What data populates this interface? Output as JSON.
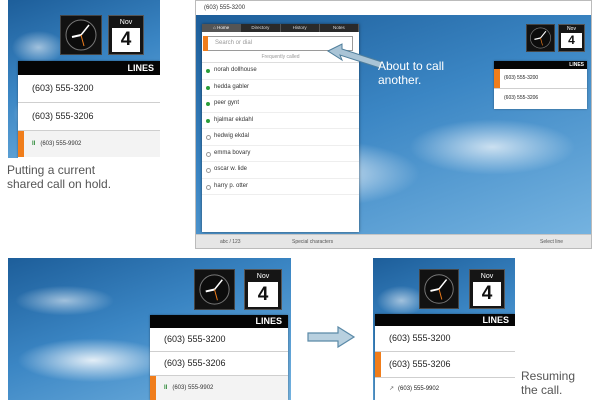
{
  "calendar": {
    "month": "Nov",
    "day": "4"
  },
  "lines_header": "LINES",
  "panel1": {
    "lines": [
      "(603) 555-3200",
      "(603) 555-3206"
    ],
    "held": "(603) 555-9902",
    "caption": [
      "Putting a current",
      "shared call on hold."
    ]
  },
  "panel2": {
    "window_title": "(603) 555-3200",
    "tabs": [
      "Home",
      "Directory",
      "History",
      "Notes"
    ],
    "search_placeholder": "Search or dial",
    "frequent_label": "Frequently called",
    "contacts": [
      {
        "name": "norah dollhouse",
        "online": true
      },
      {
        "name": "hedda gabler",
        "online": true
      },
      {
        "name": "peer gynt",
        "online": true
      },
      {
        "name": "hjalmar ekdahl",
        "online": true
      },
      {
        "name": "hedwig ekdal",
        "online": false
      },
      {
        "name": "emma bovary",
        "online": false
      },
      {
        "name": "oscar w. lide",
        "online": false
      },
      {
        "name": "harry p. otter",
        "online": false
      }
    ],
    "callout": [
      "About to call",
      "another."
    ],
    "lines": [
      "(603) 555-3200",
      "(603) 555-3206"
    ],
    "status": {
      "left": "abc / 123",
      "mid": "Special characters",
      "right": "Select line"
    }
  },
  "panel3": {
    "lines": [
      "(603) 555-3200",
      "(603) 555-3206"
    ],
    "held": "(603) 555-9902"
  },
  "panel4": {
    "lines": [
      "(603) 555-3200",
      "(603) 555-3206"
    ],
    "resumed": "(603) 555-9902",
    "caption": [
      "Resuming",
      "the call."
    ]
  },
  "colors": {
    "accent": "#f07d1b",
    "online": "#2a9d3a",
    "sky": "#3b86c4"
  }
}
